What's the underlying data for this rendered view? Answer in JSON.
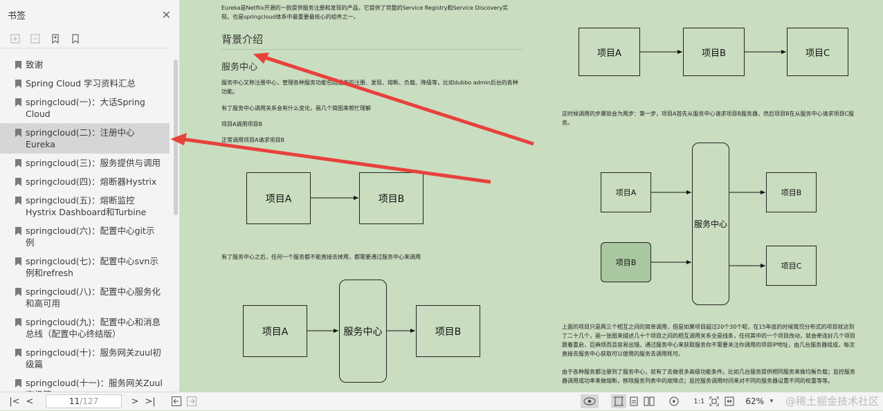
{
  "sidebar": {
    "title": "书签",
    "items": [
      {
        "label": "致谢"
      },
      {
        "label": "Spring Cloud 学习资料汇总"
      },
      {
        "label": "springcloud(一)：大话Spring Cloud"
      },
      {
        "label": "springcloud(二)：注册中心Eureka"
      },
      {
        "label": "springcloud(三)：服务提供与调用"
      },
      {
        "label": "springcloud(四)：熔断器Hystrix"
      },
      {
        "label": "springcloud(五)：熔断监控Hystrix Dashboard和Turbine"
      },
      {
        "label": "springcloud(六)：配置中心git示例"
      },
      {
        "label": "springcloud(七)：配置中心svn示例和refresh"
      },
      {
        "label": "springcloud(八)：配置中心服务化和高可用"
      },
      {
        "label": "springcloud(九)：配置中心和消息总线（配置中心终结版）"
      },
      {
        "label": "springcloud(十)：服务网关zuul初级篇"
      },
      {
        "label": "springcloud(十一)：服务网关Zuul高级篇"
      }
    ],
    "active_index": 3
  },
  "doc": {
    "intro": "Eureka是Netflix开源的一款提供服务注册和发现的产品，它提供了完整的Service Registry和Service Discovery实现。也是springcloud体系中最重要最核心的组件之一。",
    "heading_background": "背景介绍",
    "heading_service_center": "服务中心",
    "para1": "服务中心又称注册中心，管理各种服务功能包括服务的注册、发现、熔断、负载、降级等，比如dubbo admin后台的各种功能。",
    "para2": "有了服务中心调用关系会有什么变化，画几个简图来帮忙理解",
    "para3": "项目A调用项目B",
    "para4": "正常调用项目A请求项目B",
    "para5": "有了服务中心之后，任何一个服务都不能直接去掉用，都需要通过服务中心来调用",
    "right_para1": "这时候调用的步骤就会为两步：第一步，项目A首先从服务中心请求项目B服务器，然后项目B在从服务中心请求项目C服务。",
    "right_para2": "上面的项目只是两三个相互之间的简单调用，但是如果项目超过20个30个呢，在15年底的时候我司分布式的项目就达到了二十几个，画一张图来描述几十个项目之间的相互调用关系全是线条，任何其中的一个项目改动，就会牵连好几个项目跟着重启，巨麻烦而且容易出错。通过服务中心来获取服务你不需要关注你调用的项目IP地址，由几台服务器组成，每次直接去服务中心获取可以使用的服务去调用既可。",
    "right_para3": "由于各种服务都注册到了服务中心，就有了去做很多高级功能条件。比如几台服务提供相同服务来做均衡负载；监控服务器调用成功率来做熔断，移除服务列表中的故障点；监控服务调用时间来对不同的服务器设置不同的权重等等。",
    "diagram": {
      "project_a": "项目A",
      "project_b": "项目B",
      "project_c": "项目C",
      "service_center": "服务中心"
    }
  },
  "bottom": {
    "page_current": "11",
    "page_total": "/127",
    "zoom": "62%",
    "watermark": "@稀土掘金技术社区"
  },
  "colors": {
    "doc_bg": "#c9ddc0",
    "arrow": "#e8413c",
    "highlight_box": "#a9c7a0"
  }
}
